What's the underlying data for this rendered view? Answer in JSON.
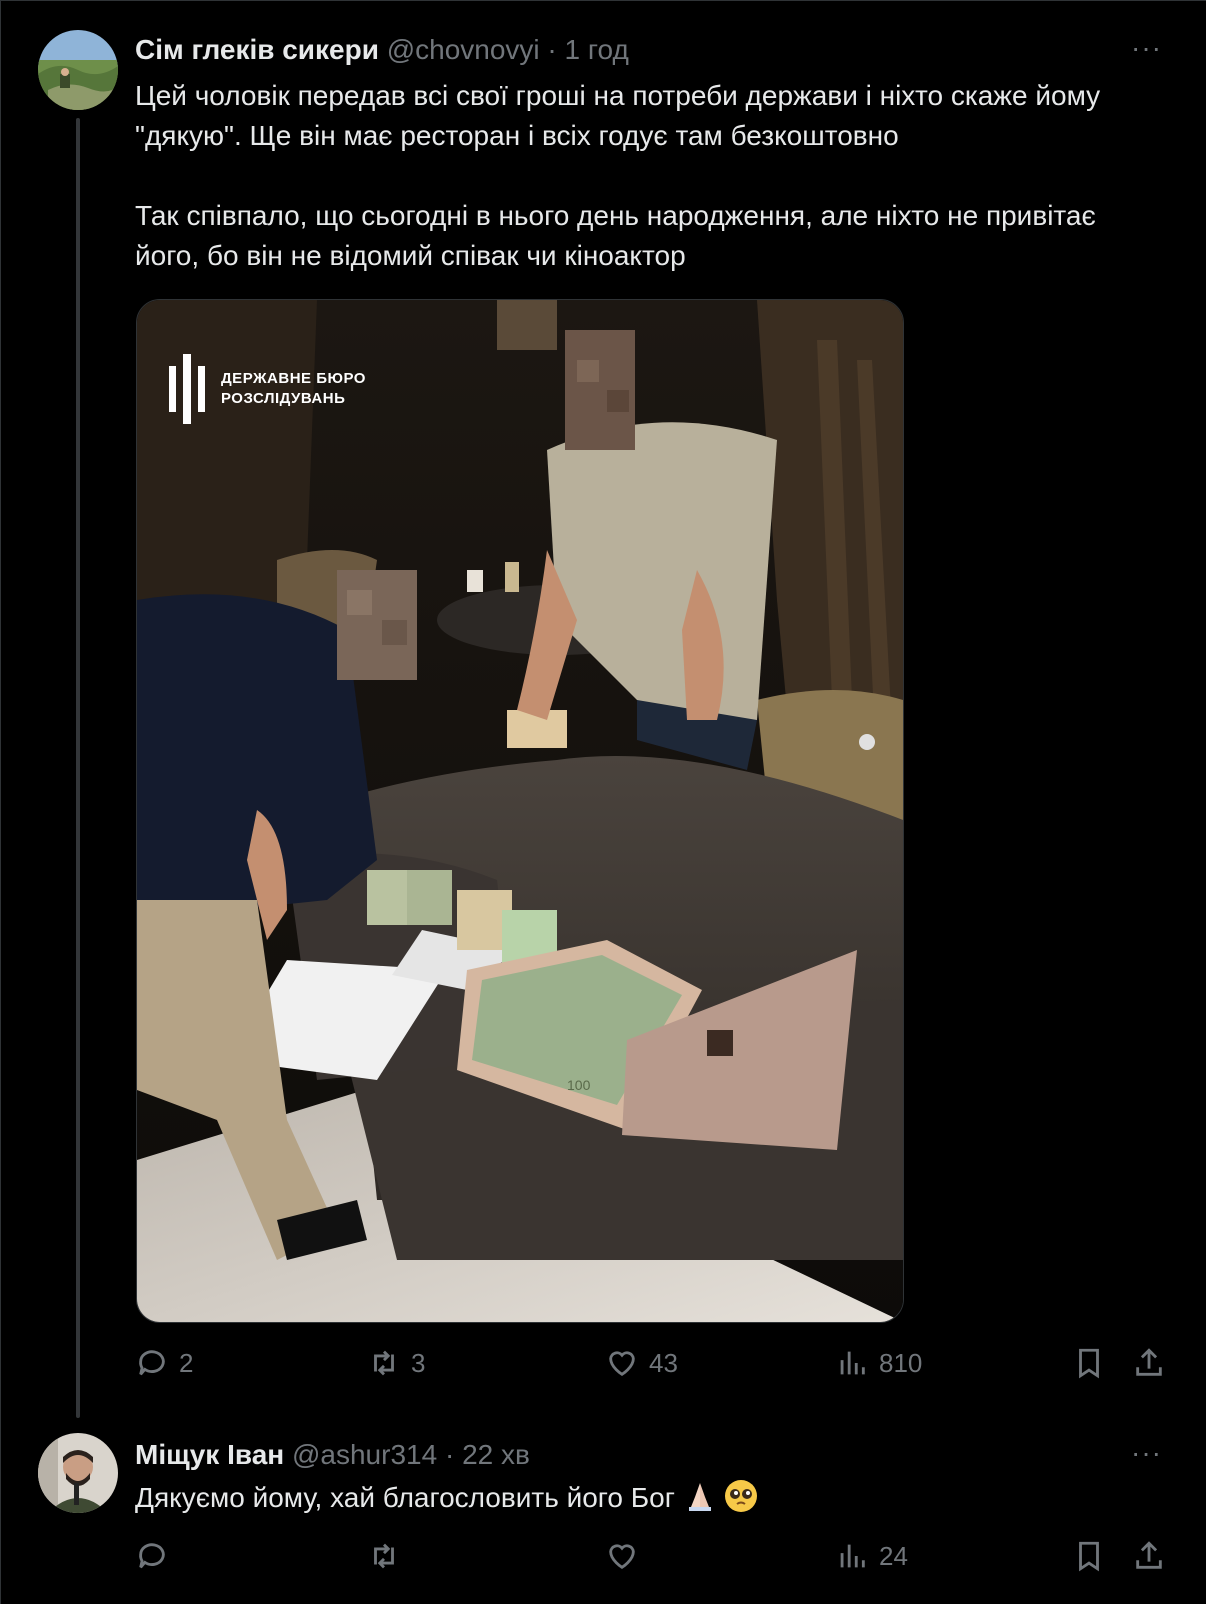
{
  "tweets": [
    {
      "author_name": "Сім глеків сикери",
      "handle": "@chovnovyi",
      "separator": "·",
      "time": "1 год",
      "text_lines": [
        "Цей чоловік передав всі свої гроші на потреби держави і ніхто скаже йому \"дякую\". Ще він має ресторан і всіх годує там безкоштовно",
        "Так співпало, що сьогодні в нього день народження, але ніхто не привітає його, бо він не відомий співак чи кіноактор"
      ],
      "media": {
        "watermark_line1": "ДЕРЖАВНЕ БЮРО",
        "watermark_line2": "РОЗСЛІДУВАНЬ",
        "banknote_label": "100"
      },
      "stats": {
        "replies": "2",
        "reposts": "3",
        "likes": "43",
        "views": "810"
      }
    },
    {
      "author_name": "Міщук Іван",
      "handle": "@ashur314",
      "separator": "·",
      "time": "22 хв",
      "text": "Дякуємо йому, хай благословить його Бог",
      "emojis": [
        "folded-hands",
        "pleading-face"
      ],
      "stats": {
        "views": "24"
      }
    }
  ],
  "more_label": "···",
  "colors": {
    "background": "#000000",
    "text": "#e7e9ea",
    "secondary": "#71767b",
    "border": "#2f3336"
  }
}
